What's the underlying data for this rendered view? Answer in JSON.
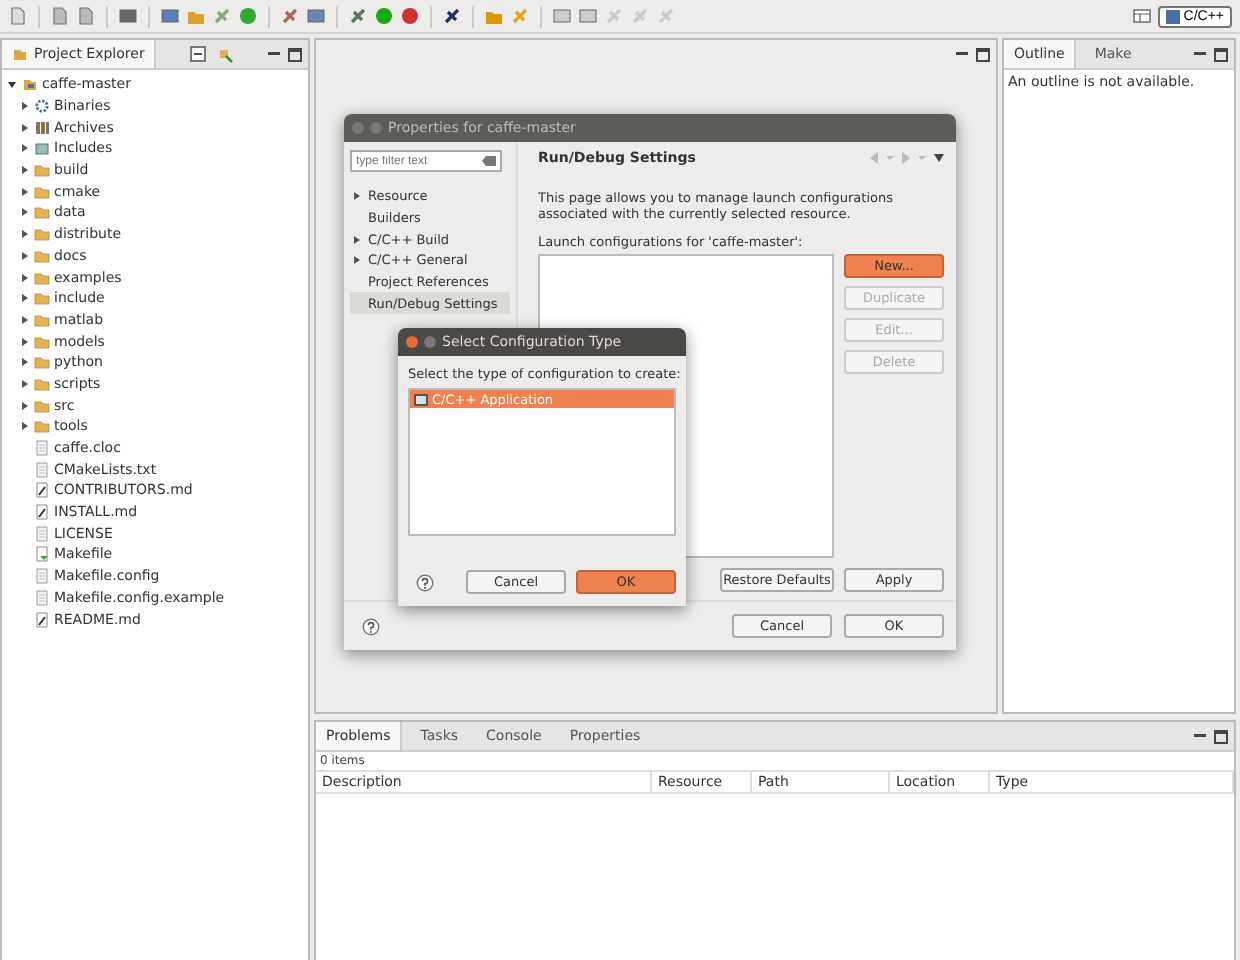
{
  "perspective": {
    "label": "C/C++",
    "selected": true
  },
  "project_explorer": {
    "title": "Project Explorer",
    "tree": [
      {
        "label": "caffe-master",
        "kind": "project",
        "expanded": true,
        "children": [
          {
            "label": "Binaries",
            "kind": "binaries",
            "expanded": false
          },
          {
            "label": "Archives",
            "kind": "archives",
            "expanded": false
          },
          {
            "label": "Includes",
            "kind": "includes",
            "expanded": false
          },
          {
            "label": "build",
            "kind": "folder",
            "expanded": false
          },
          {
            "label": "cmake",
            "kind": "folder",
            "expanded": false
          },
          {
            "label": "data",
            "kind": "folder",
            "expanded": false
          },
          {
            "label": "distribute",
            "kind": "folder",
            "expanded": false
          },
          {
            "label": "docs",
            "kind": "folder",
            "expanded": false
          },
          {
            "label": "examples",
            "kind": "folder",
            "expanded": false
          },
          {
            "label": "include",
            "kind": "folder",
            "expanded": false
          },
          {
            "label": "matlab",
            "kind": "folder",
            "expanded": false
          },
          {
            "label": "models",
            "kind": "folder",
            "expanded": false
          },
          {
            "label": "python",
            "kind": "folder",
            "expanded": false
          },
          {
            "label": "scripts",
            "kind": "folder",
            "expanded": false
          },
          {
            "label": "src",
            "kind": "folder",
            "expanded": false
          },
          {
            "label": "tools",
            "kind": "folder",
            "expanded": false
          },
          {
            "label": "caffe.cloc",
            "kind": "file"
          },
          {
            "label": "CMakeLists.txt",
            "kind": "file"
          },
          {
            "label": "CONTRIBUTORS.md",
            "kind": "markdown"
          },
          {
            "label": "INSTALL.md",
            "kind": "markdown"
          },
          {
            "label": "LICENSE",
            "kind": "file"
          },
          {
            "label": "Makefile",
            "kind": "makefile"
          },
          {
            "label": "Makefile.config",
            "kind": "file"
          },
          {
            "label": "Makefile.config.example",
            "kind": "file"
          },
          {
            "label": "README.md",
            "kind": "markdown"
          }
        ]
      }
    ]
  },
  "outline": {
    "tabs": [
      {
        "label": "Outline",
        "selected": true
      },
      {
        "label": "Make",
        "selected": false
      }
    ],
    "message": "An outline is not available."
  },
  "bottom_panel": {
    "tabs": [
      {
        "label": "Problems",
        "selected": true
      },
      {
        "label": "Tasks",
        "selected": false
      },
      {
        "label": "Console",
        "selected": false
      },
      {
        "label": "Properties",
        "selected": false
      }
    ],
    "count": "0 items",
    "columns": [
      "Description",
      "Resource",
      "Path",
      "Location",
      "Type"
    ]
  },
  "properties_dialog": {
    "title": "Properties for caffe-master",
    "filter": {
      "placeholder": "type filter text"
    },
    "categories": [
      {
        "label": "Resource",
        "expandable": true,
        "selected": false
      },
      {
        "label": "Builders",
        "expandable": false,
        "selected": false
      },
      {
        "label": "C/C++ Build",
        "expandable": true,
        "selected": false
      },
      {
        "label": "C/C++ General",
        "expandable": true,
        "selected": false
      },
      {
        "label": "Project References",
        "expandable": false,
        "selected": false
      },
      {
        "label": "Run/Debug Settings",
        "expandable": false,
        "selected": true
      }
    ],
    "heading": "Run/Debug Settings",
    "description": "This page allows you to manage launch configurations associated with the currently selected resource.",
    "list_label": "Launch configurations for 'caffe-master':",
    "side_buttons": [
      {
        "label": "New...",
        "disabled": false,
        "default": true
      },
      {
        "label": "Duplicate",
        "disabled": true,
        "default": false
      },
      {
        "label": "Edit...",
        "disabled": true,
        "default": false
      },
      {
        "label": "Delete",
        "disabled": true,
        "default": false
      }
    ],
    "restore_defaults": "Restore Defaults",
    "apply": "Apply",
    "cancel": "Cancel",
    "ok": "OK"
  },
  "select_dialog": {
    "title": "Select Configuration Type",
    "prompt": "Select the type of configuration to create:",
    "items": [
      {
        "label": "C/C++ Application",
        "selected": true
      }
    ],
    "cancel": "Cancel",
    "ok": "OK"
  }
}
